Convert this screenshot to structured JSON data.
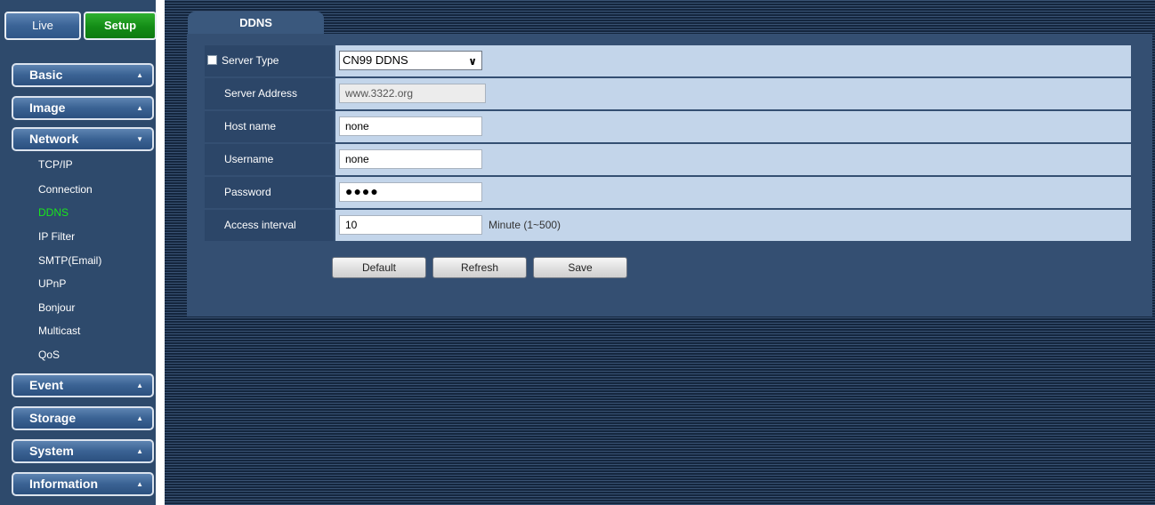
{
  "topnav": {
    "live": "Live",
    "setup": "Setup"
  },
  "sidebar": {
    "menus": {
      "basic": {
        "label": "Basic",
        "arrow": "▲"
      },
      "image": {
        "label": "Image",
        "arrow": "▲"
      },
      "network": {
        "label": "Network",
        "arrow": "▼"
      },
      "event": {
        "label": "Event",
        "arrow": "▲"
      },
      "storage": {
        "label": "Storage",
        "arrow": "▲"
      },
      "system": {
        "label": "System",
        "arrow": "▲"
      },
      "information": {
        "label": "Information",
        "arrow": "▲"
      }
    },
    "network_items": [
      {
        "label": "TCP/IP"
      },
      {
        "label": "Connection"
      },
      {
        "label": "DDNS"
      },
      {
        "label": "IP Filter"
      },
      {
        "label": "SMTP(Email)"
      },
      {
        "label": "UPnP"
      },
      {
        "label": "Bonjour"
      },
      {
        "label": "Multicast"
      },
      {
        "label": "QoS"
      }
    ],
    "active_item": "DDNS",
    "active_color": "#19e61b"
  },
  "tab": {
    "title": "DDNS"
  },
  "form": {
    "server_type": {
      "label": "Server Type",
      "value": "CN99 DDNS",
      "checked": false
    },
    "server_address": {
      "label": "Server Address",
      "value": "www.3322.org"
    },
    "host_name": {
      "label": "Host name",
      "value": "none"
    },
    "username": {
      "label": "Username",
      "value": "none"
    },
    "password": {
      "label": "Password",
      "value": "●●●●"
    },
    "access_interval": {
      "label": "Access interval",
      "value": "10",
      "hint": "Minute (1~500)"
    }
  },
  "buttons": {
    "default": "Default",
    "refresh": "Refresh",
    "save": "Save"
  }
}
